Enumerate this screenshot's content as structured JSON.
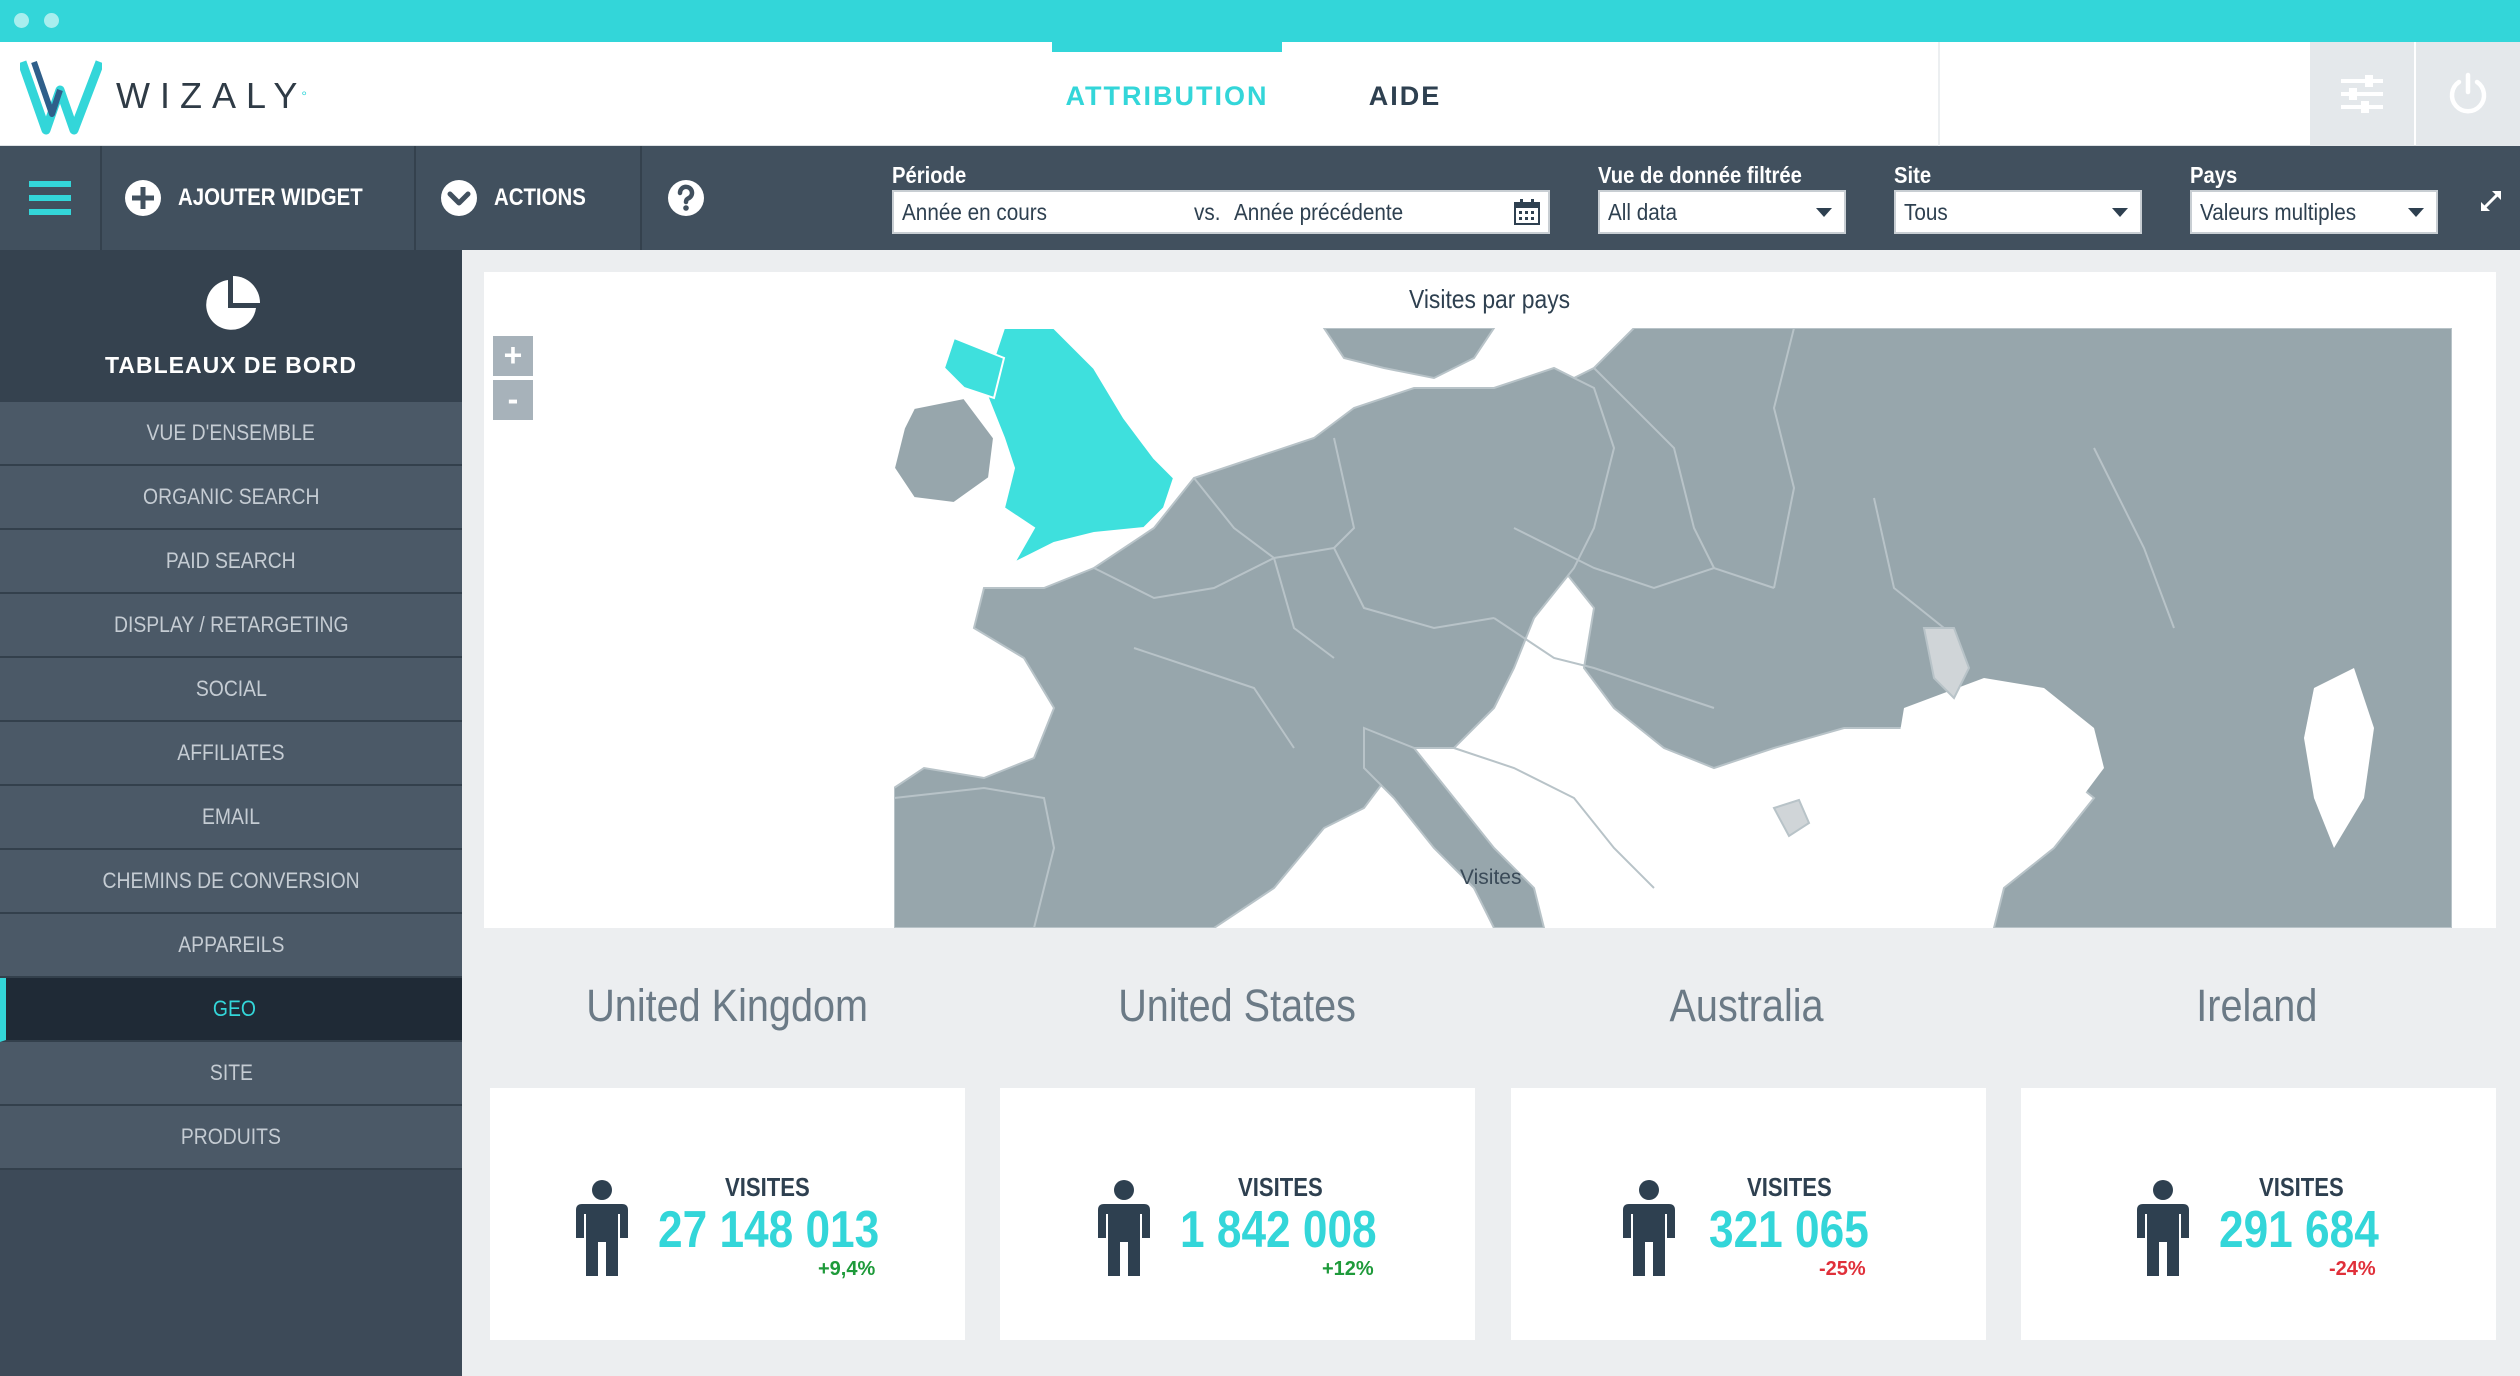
{
  "app": {
    "logo_text": "WIZALY",
    "logo_mark": "°"
  },
  "topnav": {
    "tabs": [
      {
        "label": "ATTRIBUTION",
        "active": true
      },
      {
        "label": "AIDE",
        "active": false
      }
    ]
  },
  "toolbar": {
    "add_widget": "AJOUTER WIDGET",
    "actions": "ACTIONS",
    "help_icon": "help-icon",
    "filters": {
      "period": {
        "label": "Période",
        "value": "Année en cours",
        "compare_prefix": "vs.",
        "compare_value": "Année précédente"
      },
      "view": {
        "label": "Vue de donnée filtrée",
        "value": "All data"
      },
      "site": {
        "label": "Site",
        "value": "Tous"
      },
      "country": {
        "label": "Pays",
        "value": "Valeurs multiples"
      }
    }
  },
  "sidebar": {
    "title": "TABLEAUX DE BORD",
    "items": [
      {
        "label": "VUE D'ENSEMBLE",
        "active": false
      },
      {
        "label": "ORGANIC SEARCH",
        "active": false
      },
      {
        "label": "PAID SEARCH",
        "active": false
      },
      {
        "label": "DISPLAY / RETARGETING",
        "active": false
      },
      {
        "label": "SOCIAL",
        "active": false
      },
      {
        "label": "AFFILIATES",
        "active": false
      },
      {
        "label": "EMAIL",
        "active": false
      },
      {
        "label": "CHEMINS DE CONVERSION",
        "active": false
      },
      {
        "label": "APPAREILS",
        "active": false
      },
      {
        "label": "GEO",
        "active": true
      },
      {
        "label": "SITE",
        "active": false
      },
      {
        "label": "PRODUITS",
        "active": false
      }
    ]
  },
  "map": {
    "title": "Visites par pays",
    "zoom_in": "+",
    "zoom_out": "-",
    "legend": "Visites",
    "highlighted_country": "United Kingdom",
    "colors": {
      "highlight": "#3ee0dd",
      "land": "#97a6ac",
      "no_data": "#d0d5d8",
      "water": "#ffffff"
    }
  },
  "kpis": [
    {
      "country": "United Kingdom",
      "label": "VISITES",
      "value": "27 148 013",
      "delta": "+9,4%",
      "trend": "up"
    },
    {
      "country": "United States",
      "label": "VISITES",
      "value": "1 842 008",
      "delta": "+12%",
      "trend": "up"
    },
    {
      "country": "Australia",
      "label": "VISITES",
      "value": "321 065",
      "delta": "-25%",
      "trend": "down"
    },
    {
      "country": "Ireland",
      "label": "VISITES",
      "value": "291 684",
      "delta": "-24%",
      "trend": "down"
    }
  ],
  "colors": {
    "accent": "#33d6d9",
    "toolbar": "#41505e",
    "sidebar": "#3d4a58",
    "positive": "#1e9a3a",
    "negative": "#e0303a"
  }
}
